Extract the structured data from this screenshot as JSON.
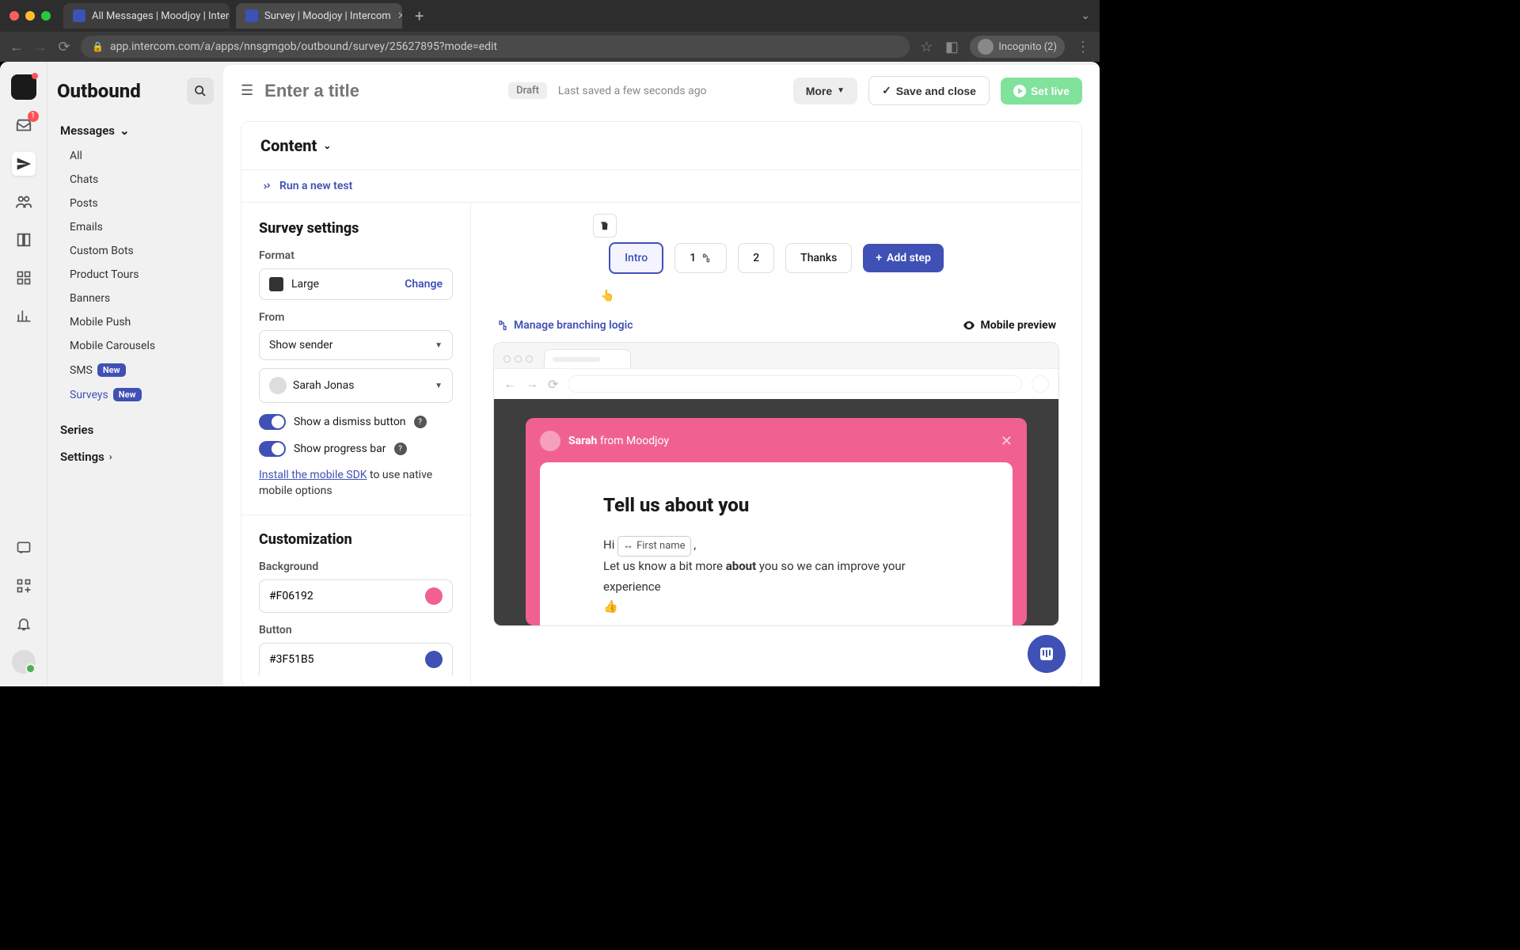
{
  "browser": {
    "tabs": [
      {
        "title": "All Messages | Moodjoy | Interc"
      },
      {
        "title": "Survey | Moodjoy | Intercom"
      }
    ],
    "url": "app.intercom.com/a/apps/nnsgmgob/outbound/survey/25627895?mode=edit",
    "incognito_label": "Incognito (2)"
  },
  "rail": {
    "inbox_badge": "1"
  },
  "sidebar": {
    "title": "Outbound",
    "messages_label": "Messages",
    "items": [
      "All",
      "Chats",
      "Posts",
      "Emails",
      "Custom Bots",
      "Product Tours",
      "Banners",
      "Mobile Push",
      "Mobile Carousels"
    ],
    "sms": {
      "label": "SMS",
      "badge": "New"
    },
    "surveys": {
      "label": "Surveys",
      "badge": "New"
    },
    "series": "Series",
    "settings": "Settings"
  },
  "topbar": {
    "title_placeholder": "Enter a title",
    "draft": "Draft",
    "saved": "Last saved a few seconds ago",
    "more": "More",
    "save": "Save and close",
    "live": "Set live"
  },
  "content": {
    "header": "Content",
    "run_test": "Run a new test"
  },
  "settings": {
    "title": "Survey settings",
    "format_label": "Format",
    "format_value": "Large",
    "change": "Change",
    "from_label": "From",
    "sender_select": "Show sender",
    "sender_name": "Sarah Jonas",
    "dismiss_label": "Show a dismiss button",
    "progress_label": "Show progress bar",
    "sdk_link": "Install the mobile SDK",
    "sdk_rest": " to use native mobile options",
    "custom_title": "Customization",
    "bg_label": "Background",
    "bg_value": "#F06192",
    "btn_label": "Button",
    "btn_value": "#3F51B5"
  },
  "steps": {
    "intro": "Intro",
    "one": "1",
    "two": "2",
    "thanks": "Thanks",
    "add": "Add step"
  },
  "preview": {
    "branching": "Manage branching logic",
    "mobile": "Mobile preview"
  },
  "survey": {
    "sender": "Sarah",
    "from": " from Moodjoy",
    "title": "Tell us about you",
    "hi": "Hi ",
    "var": "First name",
    "comma": " ,",
    "line2a": "Let us know a bit more ",
    "about": "about",
    "line2b": " you so we can improve your experience",
    "emoji": "👍"
  }
}
